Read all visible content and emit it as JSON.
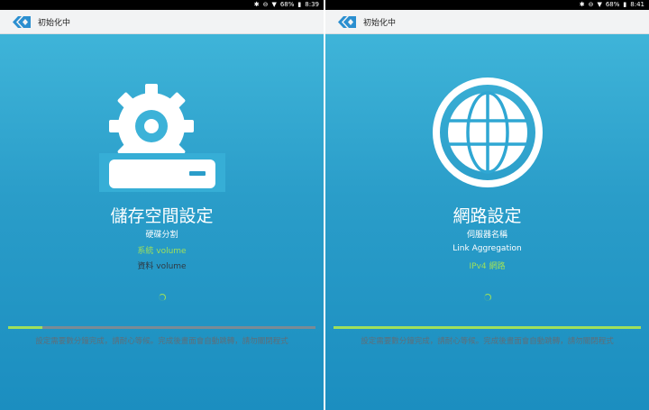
{
  "colors": {
    "accent_green": "#9fe05a",
    "panel_top": "#43b9dc",
    "panel_bottom": "#1b8ec0",
    "appbar": "#f2f3f4",
    "track": "#7a8a95"
  },
  "left": {
    "status": {
      "battery": "68%",
      "time": "8:39"
    },
    "app_title": "初始化中",
    "icon": "gear-drive-icon",
    "heading": "儲存空間設定",
    "line1": "硬碟分割",
    "line2": "系統 volume",
    "line3": "資料 volume",
    "progress": 0.11,
    "hint": "設定需要數分鐘完成，請耐心等候。完成後畫面會自動跳轉，請勿關閉程式"
  },
  "right": {
    "status": {
      "battery": "68%",
      "time": "8:41"
    },
    "app_title": "初始化中",
    "icon": "globe-icon",
    "heading": "網路設定",
    "line1": "伺服器名稱",
    "line2": "Link Aggregation",
    "line3": "IPv4 網路",
    "progress": 1.0,
    "hint": "設定需要數分鐘完成，請耐心等候。完成後畫面會自動跳轉，請勿關閉程式"
  }
}
